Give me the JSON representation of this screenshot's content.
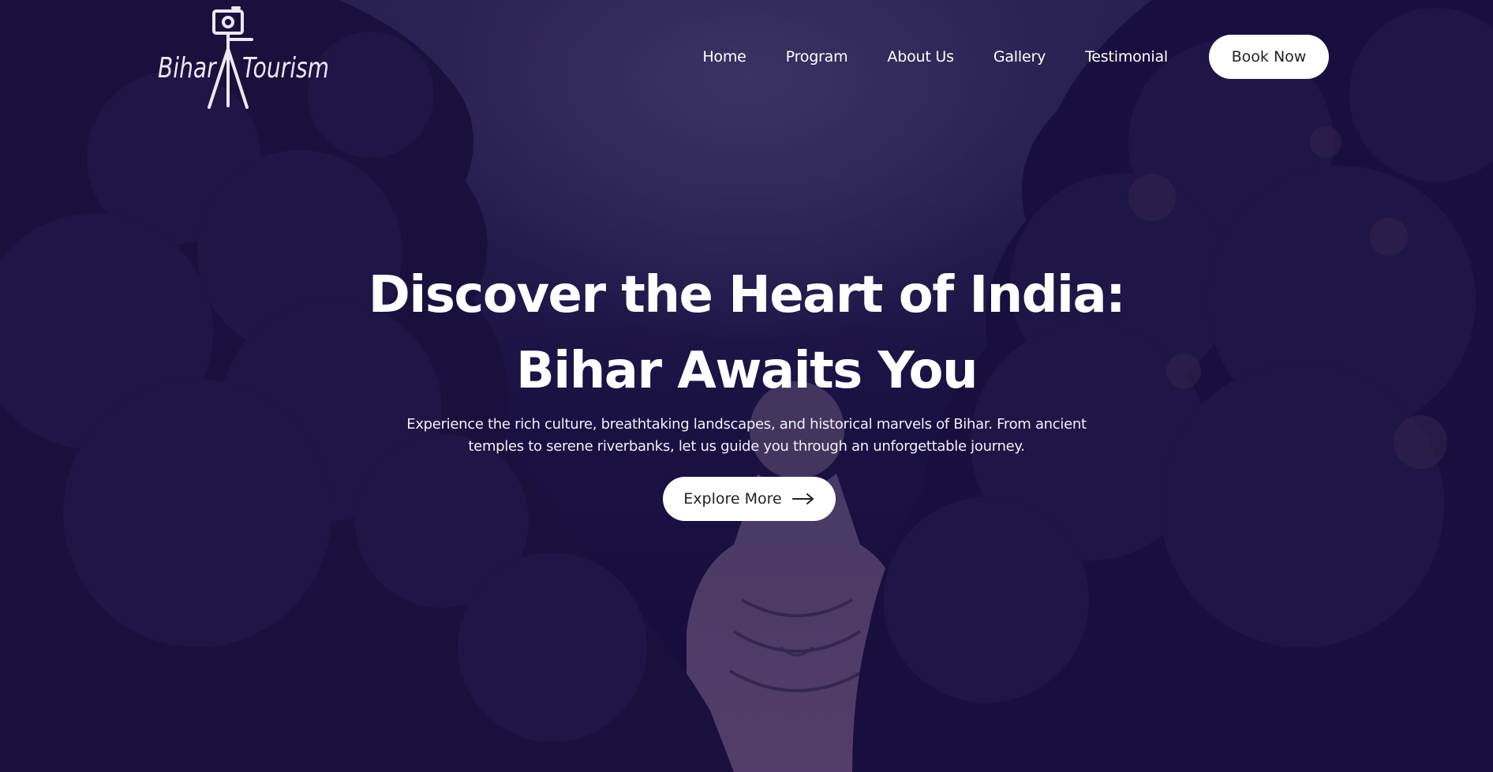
{
  "brand": {
    "name_left": "Bihar",
    "name_right": "Tourism",
    "logo_icon": "camera-tripod-icon"
  },
  "nav": {
    "items": [
      {
        "label": "Home"
      },
      {
        "label": "Program"
      },
      {
        "label": "About Us"
      },
      {
        "label": "Gallery"
      },
      {
        "label": "Testimonial"
      }
    ],
    "cta_label": "Book Now"
  },
  "hero": {
    "headline_line1": "Discover the Heart of India:",
    "headline_line2": "Bihar Awaits You",
    "subtext_line1": "Experience the rich culture, breathtaking landscapes, and historical marvels of Bihar. From ancient",
    "subtext_line2": "temples to serene riverbanks, let us guide you through an unforgettable journey.",
    "button_label": "Explore More",
    "button_icon": "arrow-right-icon",
    "background": "buddha-statue-between-trees-image"
  },
  "colors": {
    "overlay": "#1c1450",
    "button_bg": "#ffffff",
    "button_text": "#222222",
    "text": "#ffffff"
  }
}
